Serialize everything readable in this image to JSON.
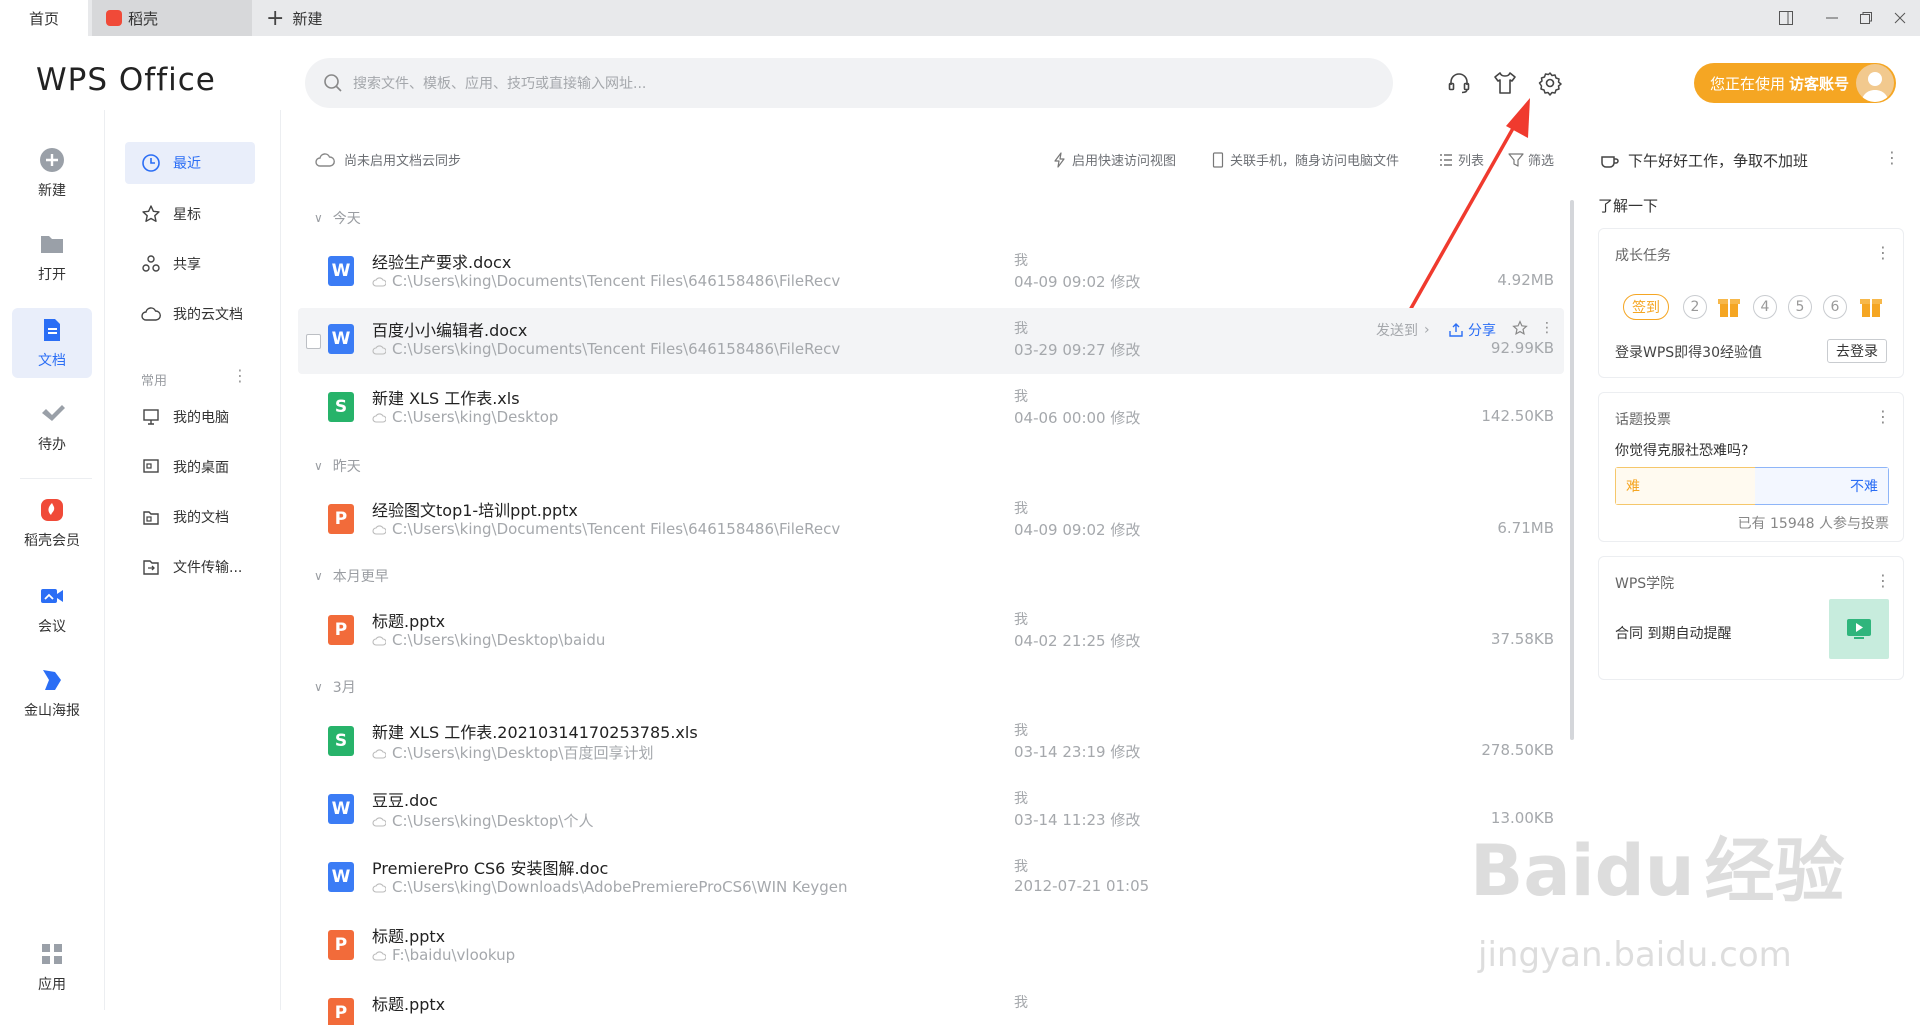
{
  "tabs": {
    "home": "首页",
    "daoke": "稻壳",
    "new": "新建"
  },
  "header": {
    "logo": "WPS Office",
    "search_placeholder": "搜索文件、模板、应用、技巧或直接输入网址...",
    "guest_prefix": "您正在使用",
    "guest_account": "访客账号"
  },
  "rail": {
    "new": "新建",
    "open": "打开",
    "docs": "文档",
    "todo": "待办",
    "daoke_member": "稻壳会员",
    "meeting": "会议",
    "poster": "金山海报",
    "apps": "应用"
  },
  "sidebar": {
    "recent": "最近",
    "starred": "星标",
    "shared": "共享",
    "cloud": "我的云文档",
    "common_label": "常用",
    "my_computer": "我的电脑",
    "my_desktop": "我的桌面",
    "my_docs": "我的文档",
    "file_transfer": "文件传输..."
  },
  "toolbar": {
    "cloud_sync": "尚未启用文档云同步",
    "quick_view": "启用快速访问视图",
    "phone_link": "关联手机，随身访问电脑文件",
    "list": "列表",
    "filter": "筛选"
  },
  "groups": {
    "today": "今天",
    "yesterday": "昨天",
    "earlier_month": "本月更早",
    "march": "3月"
  },
  "files": [
    {
      "name": "经验生产要求.docx",
      "path": "C:\\Users\\king\\Documents\\Tencent Files\\646158486\\FileRecv",
      "owner": "我",
      "date": "04-09 09:02 修改",
      "size": "4.92MB",
      "type": "W"
    },
    {
      "name": "百度小小编辑者.docx",
      "path": "C:\\Users\\king\\Documents\\Tencent Files\\646158486\\FileRecv",
      "owner": "我",
      "date": "03-29 09:27 修改",
      "size": "92.99KB",
      "type": "W"
    },
    {
      "name": "新建 XLS 工作表.xls",
      "path": "C:\\Users\\king\\Desktop",
      "owner": "我",
      "date": "04-06 00:00 修改",
      "size": "142.50KB",
      "type": "S"
    },
    {
      "name": "经验图文top1-培训ppt.pptx",
      "path": "C:\\Users\\king\\Documents\\Tencent Files\\646158486\\FileRecv",
      "owner": "我",
      "date": "04-09 09:02 修改",
      "size": "6.71MB",
      "type": "P"
    },
    {
      "name": "标题.pptx",
      "path": "C:\\Users\\king\\Desktop\\baidu",
      "owner": "我",
      "date": "04-02 21:25 修改",
      "size": "37.58KB",
      "type": "P"
    },
    {
      "name": "新建 XLS 工作表.20210314170253785.xls",
      "path": "C:\\Users\\king\\Desktop\\百度回享计划",
      "owner": "我",
      "date": "03-14 23:19 修改",
      "size": "278.50KB",
      "type": "S"
    },
    {
      "name": "豆豆.doc",
      "path": "C:\\Users\\king\\Desktop\\个人",
      "owner": "我",
      "date": "03-14 11:23 修改",
      "size": "13.00KB",
      "type": "W"
    },
    {
      "name": "PremierePro CS6 安装图解.doc",
      "path": "C:\\Users\\king\\Downloads\\AdobePremiereProCS6\\WIN Keygen",
      "owner": "我",
      "date": "2012-07-21 01:05",
      "size": "",
      "type": "W"
    },
    {
      "name": "标题.pptx",
      "path": "F:\\baidu\\vlookup",
      "owner": "",
      "date": "",
      "size": "",
      "type": "P"
    },
    {
      "name": "标题.pptx",
      "path": "",
      "owner": "我",
      "date": "",
      "size": "",
      "type": "P"
    }
  ],
  "row_actions": {
    "send_to": "发送到",
    "share": "分享"
  },
  "right": {
    "greeting": "下午好好工作，争取不加班",
    "learn": "了解一下",
    "growth_title": "成长任务",
    "signin": "签到",
    "steps": [
      "2",
      "4",
      "5",
      "6"
    ],
    "login_tip": "登录WPS即得30经验值",
    "login_btn": "去登录",
    "vote_title": "话题投票",
    "vote_question": "你觉得克服社恐难吗?",
    "vote_hard": "难",
    "vote_easy": "不难",
    "vote_count": "已有 15948 人参与投票",
    "academy_title": "WPS学院",
    "academy_item": "合同 到期自动提醒"
  },
  "watermark": {
    "brand": "Bai",
    "brand_du": "du",
    "brand_cn": "经验",
    "url": "jingyan.baidu.com"
  },
  "colors": {
    "accent": "#2b6ef5",
    "guest_orange": "#f5a623",
    "annotation_red": "#f03a2e"
  }
}
